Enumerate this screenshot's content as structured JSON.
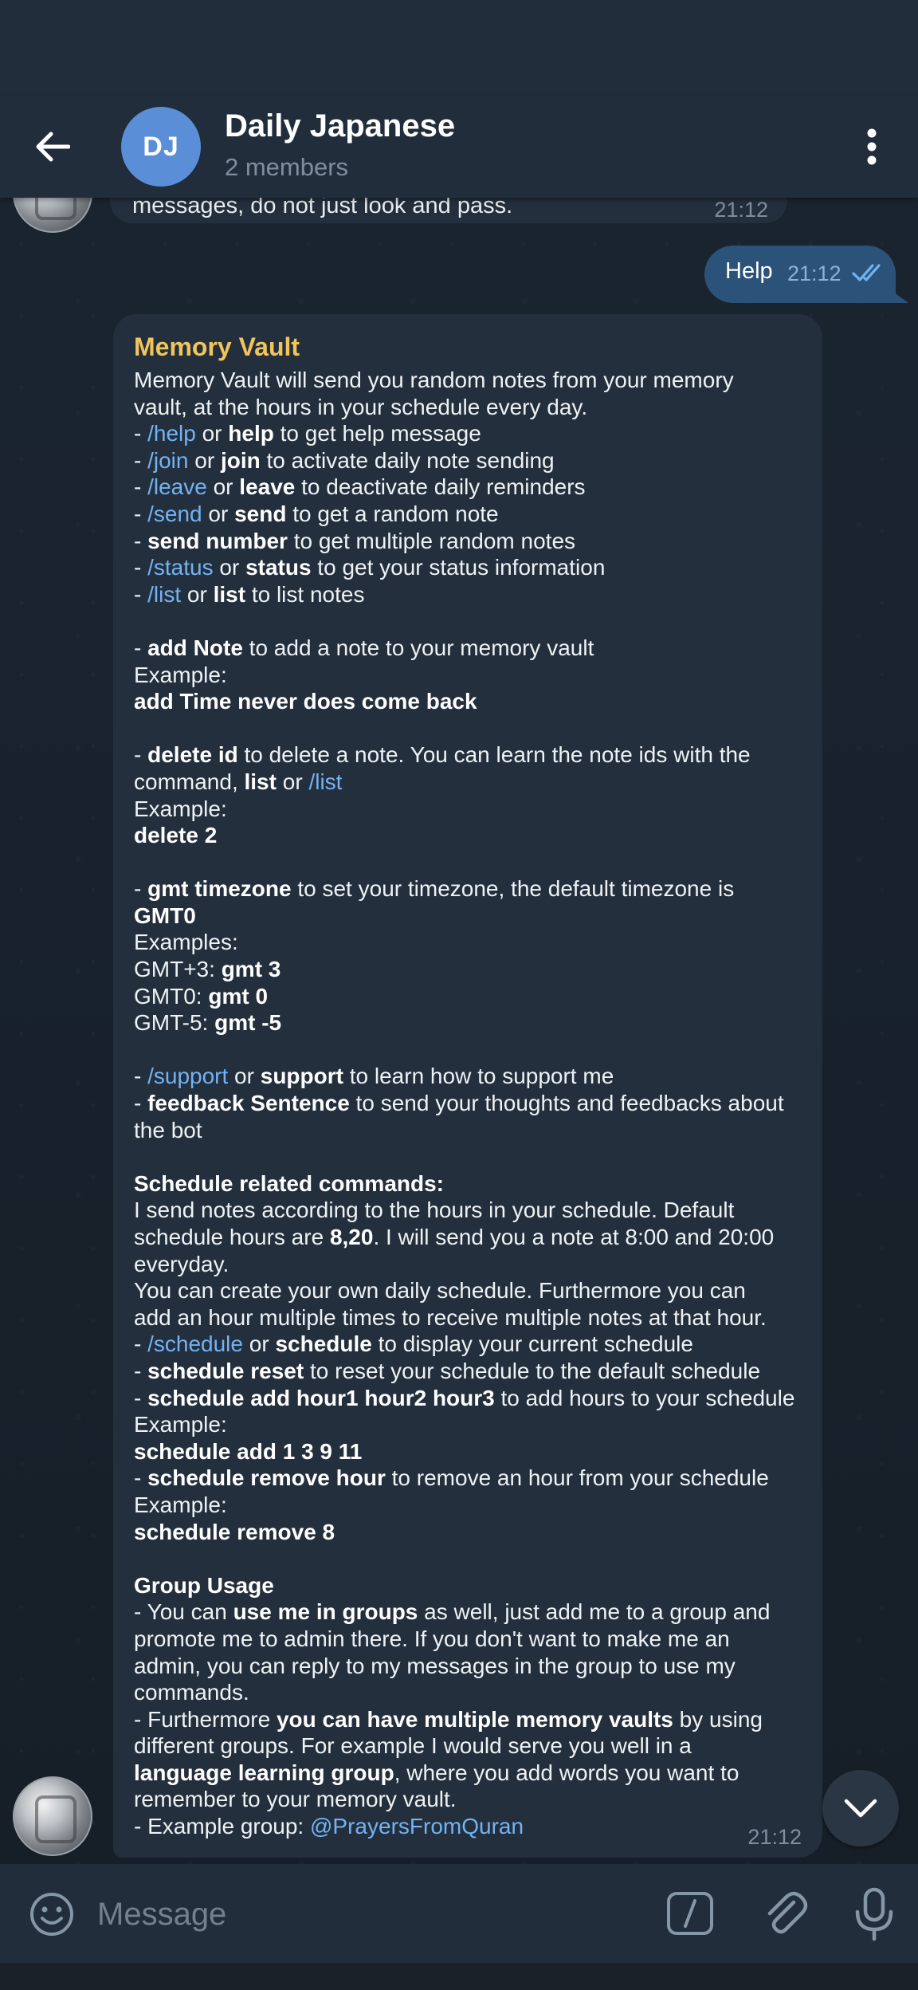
{
  "header": {
    "back_icon": "arrow-left-icon",
    "avatar_initials": "DJ",
    "avatar_color": "#5a8fd8",
    "title": "Daily Japanese",
    "subtitle": "2 members",
    "more_icon": "more-vertical-icon"
  },
  "previous_message": {
    "text": "messages, do not just look and pass.",
    "time": "21:12"
  },
  "outgoing_message": {
    "text": "Help",
    "time": "21:12",
    "status_icon": "double-check-icon"
  },
  "bot_message": {
    "sender": "Memory Vault",
    "sender_color": "#f2c55c",
    "link_color": "#73b3f3",
    "time": "21:12",
    "lines": [
      [
        {
          "t": "Memory Vault will send you random notes from your memory"
        }
      ],
      [
        {
          "t": "vault, at the hours in your schedule every day."
        }
      ],
      [
        {
          "t": "- "
        },
        {
          "t": "/help",
          "s": "cmd"
        },
        {
          "t": " or "
        },
        {
          "t": "help",
          "s": "b"
        },
        {
          "t": " to get help message"
        }
      ],
      [
        {
          "t": "- "
        },
        {
          "t": "/join",
          "s": "cmd"
        },
        {
          "t": " or "
        },
        {
          "t": "join",
          "s": "b"
        },
        {
          "t": " to activate daily note sending"
        }
      ],
      [
        {
          "t": "- "
        },
        {
          "t": "/leave",
          "s": "cmd"
        },
        {
          "t": " or "
        },
        {
          "t": "leave",
          "s": "b"
        },
        {
          "t": " to deactivate daily reminders"
        }
      ],
      [
        {
          "t": "- "
        },
        {
          "t": "/send",
          "s": "cmd"
        },
        {
          "t": " or "
        },
        {
          "t": "send",
          "s": "b"
        },
        {
          "t": " to get a random note"
        }
      ],
      [
        {
          "t": "- "
        },
        {
          "t": "send number",
          "s": "b"
        },
        {
          "t": " to get multiple random notes"
        }
      ],
      [
        {
          "t": "- "
        },
        {
          "t": "/status",
          "s": "cmd"
        },
        {
          "t": " or "
        },
        {
          "t": "status",
          "s": "b"
        },
        {
          "t": " to get your status information"
        }
      ],
      [
        {
          "t": "- "
        },
        {
          "t": "/list",
          "s": "cmd"
        },
        {
          "t": " or "
        },
        {
          "t": "list",
          "s": "b"
        },
        {
          "t": " to list notes"
        }
      ],
      [],
      [
        {
          "t": "- "
        },
        {
          "t": "add Note",
          "s": "b"
        },
        {
          "t": " to add a note to your memory vault"
        }
      ],
      [
        {
          "t": "Example:"
        }
      ],
      [
        {
          "t": "add Time never does come back",
          "s": "b"
        }
      ],
      [],
      [
        {
          "t": "- "
        },
        {
          "t": "delete id",
          "s": "b"
        },
        {
          "t": " to delete a note. You can learn the note ids with the"
        }
      ],
      [
        {
          "t": "command, "
        },
        {
          "t": "list",
          "s": "b"
        },
        {
          "t": " or "
        },
        {
          "t": "/list",
          "s": "cmd"
        }
      ],
      [
        {
          "t": "Example:"
        }
      ],
      [
        {
          "t": "delete 2",
          "s": "b"
        }
      ],
      [],
      [
        {
          "t": "- "
        },
        {
          "t": "gmt timezone",
          "s": "b"
        },
        {
          "t": " to set your timezone,  the default timezone is"
        }
      ],
      [
        {
          "t": "GMT0",
          "s": "b"
        }
      ],
      [
        {
          "t": "Examples:"
        }
      ],
      [
        {
          "t": "GMT+3: "
        },
        {
          "t": "gmt 3",
          "s": "b"
        }
      ],
      [
        {
          "t": "GMT0: "
        },
        {
          "t": "gmt 0",
          "s": "b"
        }
      ],
      [
        {
          "t": "GMT-5: "
        },
        {
          "t": "gmt -5",
          "s": "b"
        }
      ],
      [],
      [
        {
          "t": "- "
        },
        {
          "t": "/support",
          "s": "cmd"
        },
        {
          "t": " or "
        },
        {
          "t": "support",
          "s": "b"
        },
        {
          "t": " to learn how to support me"
        }
      ],
      [
        {
          "t": "- "
        },
        {
          "t": "feedback Sentence",
          "s": "b"
        },
        {
          "t": " to send your thoughts and feedbacks about"
        }
      ],
      [
        {
          "t": "the bot"
        }
      ],
      [],
      [
        {
          "t": "Schedule related commands:",
          "s": "b"
        }
      ],
      [
        {
          "t": "I send notes according to the hours in your schedule. Default"
        }
      ],
      [
        {
          "t": "schedule hours are "
        },
        {
          "t": "8,20",
          "s": "b"
        },
        {
          "t": ". I will send you a note at 8:00 and 20:00"
        }
      ],
      [
        {
          "t": "everyday."
        }
      ],
      [
        {
          "t": "You can create your own daily schedule. Furthermore you can"
        }
      ],
      [
        {
          "t": "add an hour multiple times to receive multiple notes at that hour."
        }
      ],
      [
        {
          "t": "- "
        },
        {
          "t": "/schedule",
          "s": "cmd"
        },
        {
          "t": " or "
        },
        {
          "t": "schedule",
          "s": "b"
        },
        {
          "t": " to display your current schedule"
        }
      ],
      [
        {
          "t": "- "
        },
        {
          "t": "schedule reset",
          "s": "b"
        },
        {
          "t": " to reset your schedule to the default schedule"
        }
      ],
      [
        {
          "t": "- "
        },
        {
          "t": "schedule add hour1 hour2 hour3",
          "s": "b"
        },
        {
          "t": " to add hours to your schedule"
        }
      ],
      [
        {
          "t": "Example:"
        }
      ],
      [
        {
          "t": "schedule add 1 3 9 11",
          "s": "b"
        }
      ],
      [
        {
          "t": "- "
        },
        {
          "t": "schedule remove hour",
          "s": "b"
        },
        {
          "t": " to remove an hour from your schedule"
        }
      ],
      [
        {
          "t": "Example:"
        }
      ],
      [
        {
          "t": "schedule remove 8",
          "s": "b"
        }
      ],
      [],
      [
        {
          "t": "Group Usage",
          "s": "b"
        }
      ],
      [
        {
          "t": " - You can "
        },
        {
          "t": "use me in groups",
          "s": "b"
        },
        {
          "t": " as well, just add me to a group and"
        }
      ],
      [
        {
          "t": "promote me to admin there. If you don't want to make me an"
        }
      ],
      [
        {
          "t": "admin, you can reply to my messages in the group to use my"
        }
      ],
      [
        {
          "t": "commands."
        }
      ],
      [
        {
          "t": "- Furthermore "
        },
        {
          "t": "you can have multiple memory vaults",
          "s": "b"
        },
        {
          "t": " by using"
        }
      ],
      [
        {
          "t": "different groups. For example I would serve you well in a"
        }
      ],
      [
        {
          "t": "language learning group",
          "s": "b"
        },
        {
          "t": ", where you add words you want to"
        }
      ],
      [
        {
          "t": "remember to your memory vault."
        }
      ],
      [
        {
          "t": "- Example group: "
        },
        {
          "t": "@PrayersFromQuran",
          "s": "cmd"
        }
      ]
    ]
  },
  "scroll_button_icon": "chevron-down-icon",
  "composer": {
    "placeholder": "Message",
    "emoji_icon": "emoji-icon",
    "command_icon": "slash-command-icon",
    "attach_icon": "paperclip-icon",
    "mic_icon": "microphone-icon"
  },
  "colors": {
    "header_bg": "#212d3b",
    "incoming_bubble": "#242f3d",
    "outgoing_bubble": "#2b5278",
    "background": "#172028"
  }
}
